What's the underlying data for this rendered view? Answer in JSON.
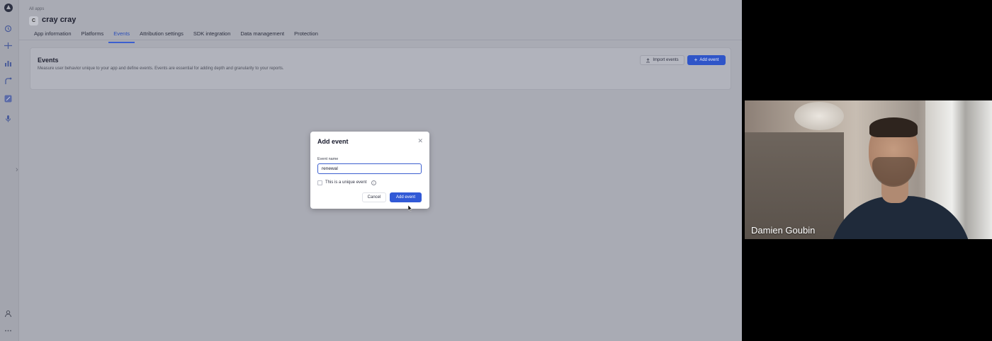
{
  "header": {
    "breadcrumb": "All apps",
    "app_badge": "C",
    "app_title": "cray cray",
    "tabs": [
      {
        "label": "App information"
      },
      {
        "label": "Platforms"
      },
      {
        "label": "Events"
      },
      {
        "label": "Attribution settings"
      },
      {
        "label": "SDK integration"
      },
      {
        "label": "Data management"
      },
      {
        "label": "Protection"
      }
    ],
    "active_tab": "Events"
  },
  "sidebar": {
    "icons": [
      "history-icon",
      "split-icon",
      "bar-chart-icon",
      "flow-icon",
      "percent-icon",
      "microphone-icon"
    ],
    "bottom_icons": [
      "user-icon",
      "more-icon"
    ]
  },
  "events_section": {
    "title": "Events",
    "description": "Measure user behavior unique to your app and define events. Events are essential for adding depth and granularity to your reports.",
    "import_label": "Import events",
    "add_label": "Add event"
  },
  "modal": {
    "title": "Add event",
    "field_label": "Event name",
    "field_value": "renewal",
    "checkbox_label": "This is a unique event",
    "checkbox_checked": false,
    "cancel_label": "Cancel",
    "submit_label": "Add event"
  },
  "video": {
    "participant_name": "Damien Goubin"
  },
  "colors": {
    "accent": "#3159d6",
    "overlay": "#a9abb4"
  }
}
